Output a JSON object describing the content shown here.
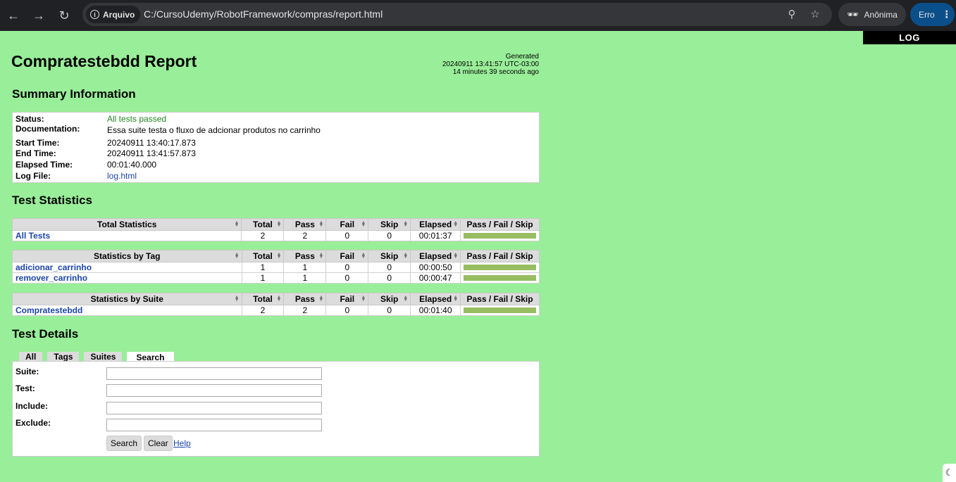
{
  "browser": {
    "site_chip": "Arquivo",
    "url": "C:/CursoUdemy/RobotFramework/compras/report.html",
    "profile": "Anônima",
    "error": "Erro"
  },
  "log_tab": "LOG",
  "report_title": "Compratestebdd Report",
  "generated": {
    "label": "Generated",
    "timestamp": "20240911 13:41:57 UTC-03:00",
    "ago": "14 minutes 39 seconds ago"
  },
  "summary": {
    "heading": "Summary Information",
    "rows": [
      {
        "label": "Status:",
        "value": "All tests passed"
      },
      {
        "label": "Documentation:",
        "value": "Essa suite testa o fluxo de adcionar produtos no carrinho"
      },
      {
        "label": "Start Time:",
        "value": "20240911 13:40:17.873"
      },
      {
        "label": "End Time:",
        "value": "20240911 13:41:57.873"
      },
      {
        "label": "Elapsed Time:",
        "value": "00:01:40.000"
      },
      {
        "label": "Log File:",
        "value": "log.html"
      }
    ]
  },
  "statistics": {
    "heading": "Test Statistics",
    "columns": [
      "Total",
      "Pass",
      "Fail",
      "Skip",
      "Elapsed",
      "Pass / Fail / Skip"
    ],
    "total": {
      "title": "Total Statistics",
      "rows": [
        {
          "name": "All Tests",
          "total": "2",
          "pass": "2",
          "fail": "0",
          "skip": "0",
          "elapsed": "00:01:37",
          "pass_fraction": 1.0
        }
      ]
    },
    "tag": {
      "title": "Statistics by Tag",
      "rows": [
        {
          "name": "adicionar_carrinho",
          "total": "1",
          "pass": "1",
          "fail": "0",
          "skip": "0",
          "elapsed": "00:00:50",
          "pass_fraction": 1.0
        },
        {
          "name": "remover_carrinho",
          "total": "1",
          "pass": "1",
          "fail": "0",
          "skip": "0",
          "elapsed": "00:00:47",
          "pass_fraction": 1.0
        }
      ]
    },
    "suite": {
      "title": "Statistics by Suite",
      "rows": [
        {
          "name": "Compratestebdd",
          "total": "2",
          "pass": "2",
          "fail": "0",
          "skip": "0",
          "elapsed": "00:01:40",
          "pass_fraction": 1.0
        }
      ]
    }
  },
  "details": {
    "heading": "Test Details",
    "tabs": [
      "All",
      "Tags",
      "Suites",
      "Search"
    ],
    "active_tab": "Search",
    "fields": [
      {
        "label": "Suite:",
        "value": ""
      },
      {
        "label": "Test:",
        "value": ""
      },
      {
        "label": "Include:",
        "value": ""
      },
      {
        "label": "Exclude:",
        "value": ""
      }
    ],
    "search_button": "Search",
    "clear_button": "Clear",
    "help_link": "Help"
  },
  "colors": {
    "background": "#99ee99",
    "pass_bar": "#97bd61",
    "link": "#1b45a8",
    "chrome": "#202124"
  }
}
